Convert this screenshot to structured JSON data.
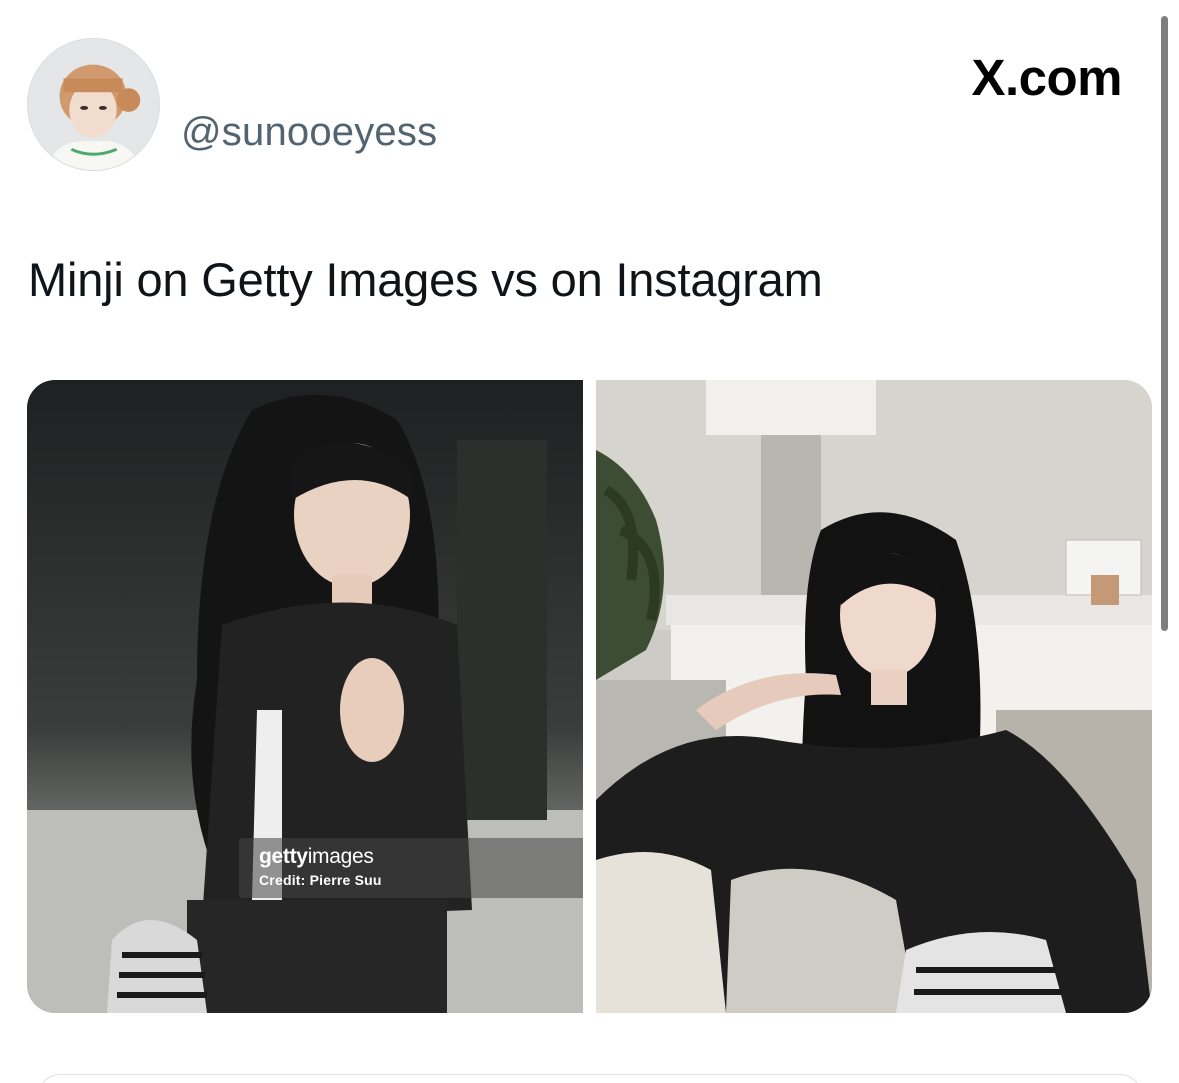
{
  "post": {
    "handle": "@sunooeyess",
    "text": "Minji on Getty Images vs on Instagram",
    "brand": "X.com"
  },
  "media": {
    "left_photo": {
      "watermark_brand_bold": "getty",
      "watermark_brand_light": "images",
      "watermark_credit": "Credit: Pierre Suu"
    }
  },
  "colors": {
    "handle": "#536471",
    "text": "#0f1419"
  }
}
